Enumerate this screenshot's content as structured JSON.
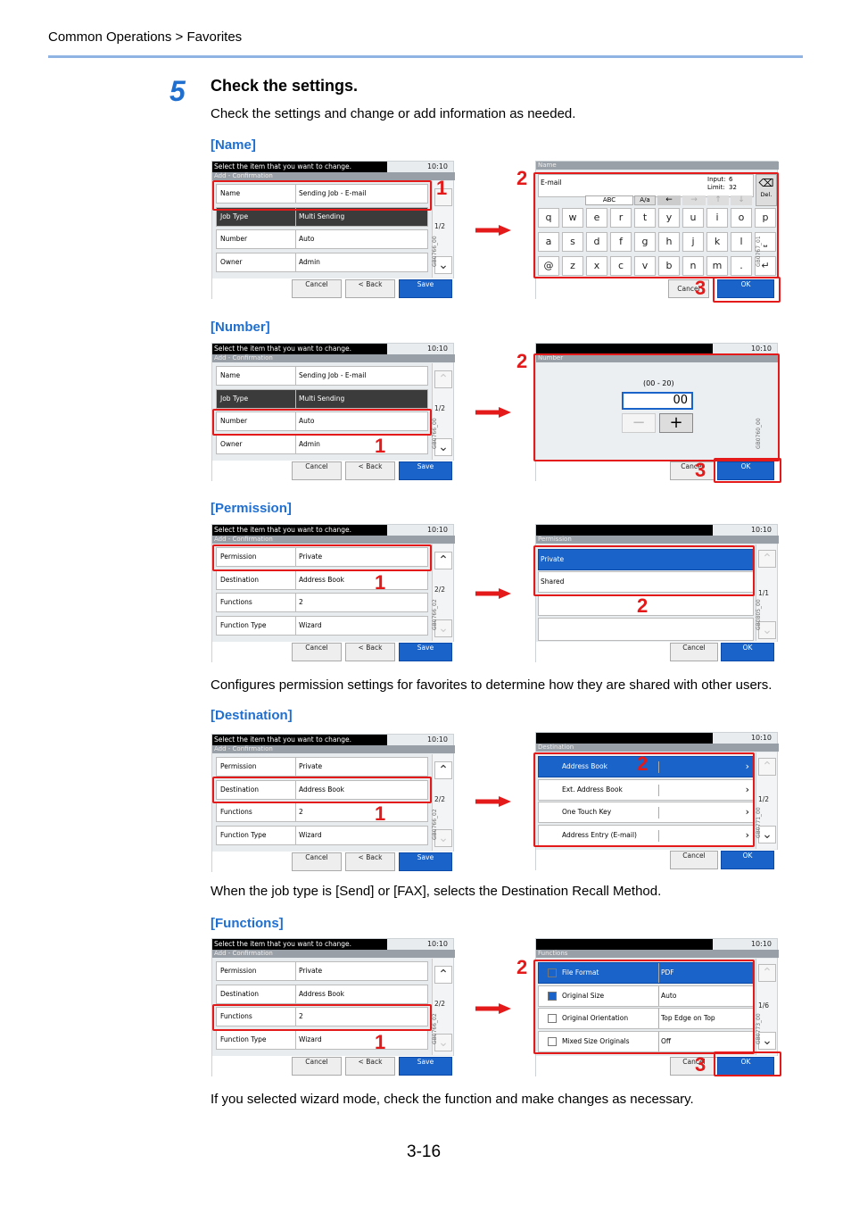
{
  "breadcrumb": "Common Operations > Favorites",
  "step": {
    "number": "5",
    "title": "Check the settings.",
    "intro": "Check the settings and change or add information as needed."
  },
  "sections": {
    "name": "[Name]",
    "number": "[Number]",
    "permission": "[Permission]",
    "destination": "[Destination]",
    "functions": "[Functions]"
  },
  "notes": {
    "permission": "Configures permission settings for favorites to determine how they are shared with other users.",
    "destination": "When the job type is [Send] or [FAX], selects the Destination Recall Method.",
    "functions": "If you selected wizard mode, check the function and make changes as necessary."
  },
  "page_number": "3-16",
  "confirm": {
    "prompt": "Select the item that you want to change.",
    "subtitle": "Add - Confirmation",
    "time": "10:10",
    "rows1": [
      {
        "k": "Name",
        "v": "Sending Job - E-mail"
      },
      {
        "k": "Job Type",
        "v": "Multi Sending"
      },
      {
        "k": "Number",
        "v": "Auto"
      },
      {
        "k": "Owner",
        "v": "Admin"
      }
    ],
    "rows2": [
      {
        "k": "Permission",
        "v": "Private"
      },
      {
        "k": "Destination",
        "v": "Address Book"
      },
      {
        "k": "Functions",
        "v": "2"
      },
      {
        "k": "Function Type",
        "v": "Wizard"
      }
    ],
    "page1": "1/2",
    "page2": "2/2",
    "cancel": "Cancel",
    "back": "< Back",
    "save": "Save",
    "tags": [
      "GB0766_00",
      "GB0766_00",
      "GB0766_02",
      "GB0766_02",
      "GB0766_02"
    ]
  },
  "name_screen": {
    "title": "Name",
    "field": "E-mail",
    "input_label": "Input:",
    "input_val": "6",
    "limit_label": "Limit:",
    "limit_val": "32",
    "mode1": "ABC",
    "mode2": "A/a",
    "del": "Del.",
    "ok": "OK",
    "cancel": "Cancel",
    "tag": "GB0767_01",
    "keys": [
      [
        "q",
        "w",
        "e",
        "r",
        "t",
        "y",
        "u",
        "i",
        "o",
        "p"
      ],
      [
        "a",
        "s",
        "d",
        "f",
        "g",
        "h",
        "j",
        "k",
        "l",
        "⎵"
      ],
      [
        "@",
        "z",
        "x",
        "c",
        "v",
        "b",
        "n",
        "m",
        ".",
        "↵"
      ]
    ]
  },
  "number_screen": {
    "title": "Number",
    "range": "(00 - 20)",
    "value": "00",
    "minus": "−",
    "plus": "+",
    "ok": "OK",
    "cancel": "Cancel",
    "tag": "GB0760_00"
  },
  "permission_screen": {
    "title": "Permission",
    "options": [
      "Private",
      "Shared"
    ],
    "page": "1/1",
    "ok": "OK",
    "cancel": "Cancel",
    "tag": "GB0805_00"
  },
  "destination_screen": {
    "title": "Destination",
    "options": [
      "Address Book",
      "Ext. Address Book",
      "One Touch Key",
      "Address Entry (E-mail)"
    ],
    "page": "1/2",
    "ok": "OK",
    "cancel": "Cancel",
    "tag": "GB0771_00"
  },
  "functions_screen": {
    "title": "Functions",
    "rows": [
      {
        "k": "File Format",
        "v": "PDF"
      },
      {
        "k": "Original Size",
        "v": "Auto"
      },
      {
        "k": "Original Orientation",
        "v": "Top Edge on Top"
      },
      {
        "k": "Mixed Size Originals",
        "v": "Off"
      }
    ],
    "page": "1/6",
    "ok": "OK",
    "cancel": "Cancel",
    "tag": "GB0773_00"
  },
  "callouts": {
    "one": "1",
    "two": "2",
    "three": "3"
  },
  "colors": {
    "accent": "#1f6fd1",
    "callout": "#e41a1a",
    "rule": "#8fb4e3"
  }
}
